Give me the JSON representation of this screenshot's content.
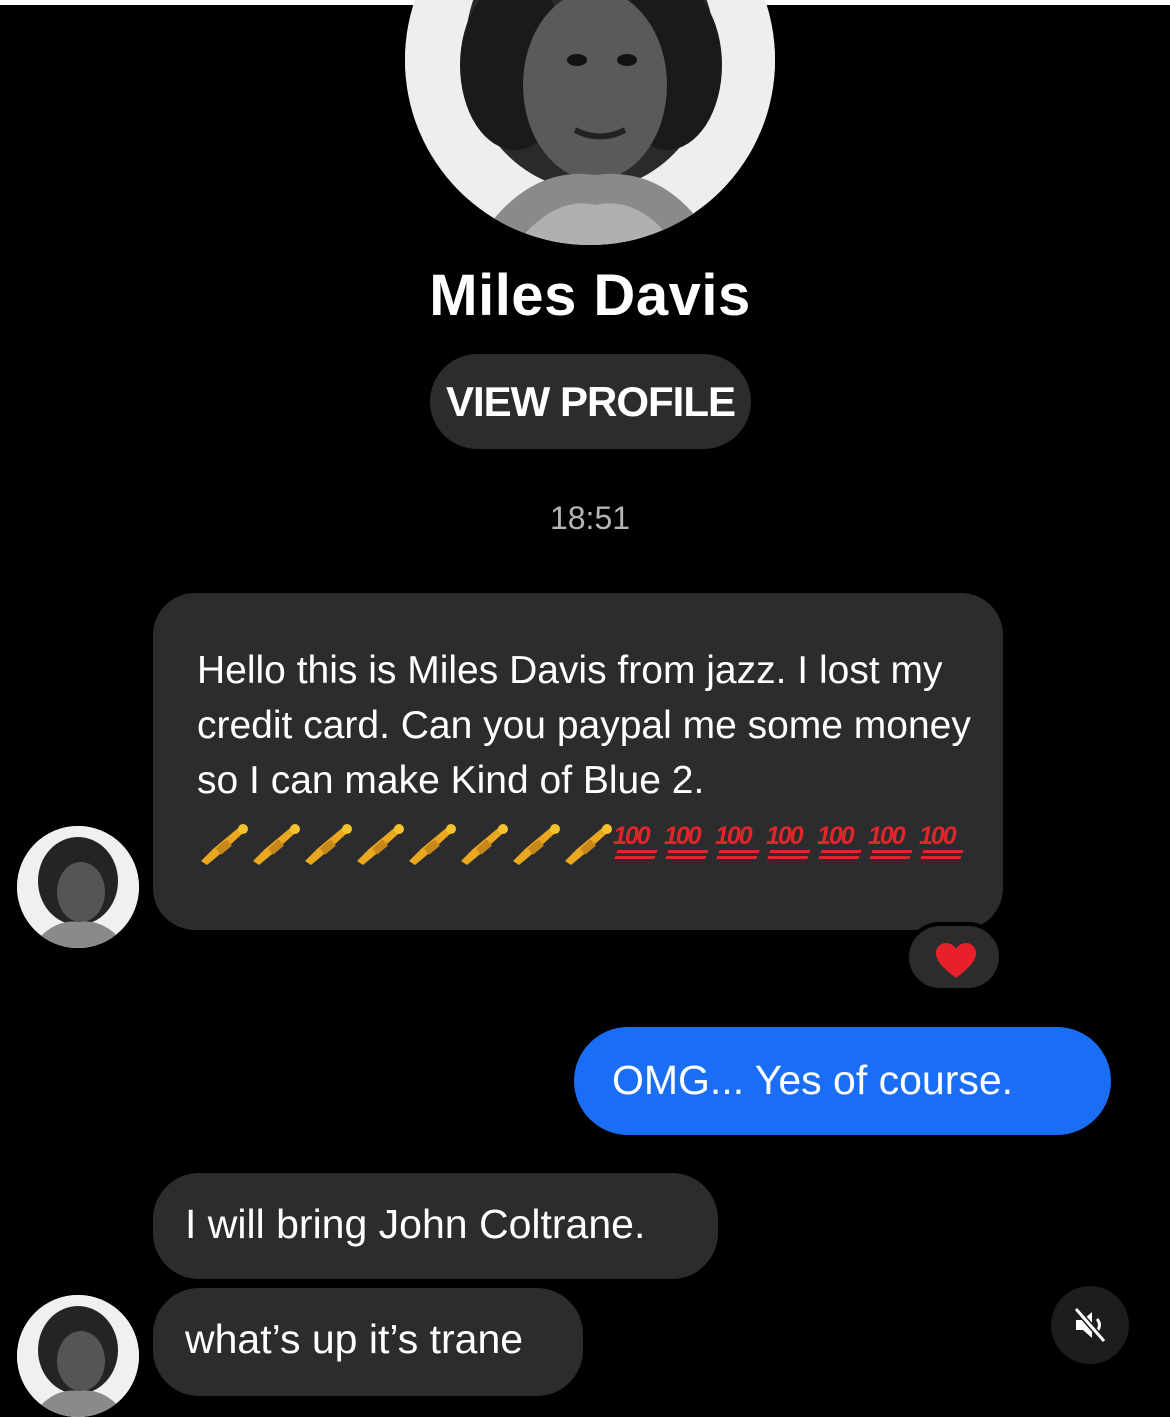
{
  "contact": {
    "name": "Miles Davis",
    "view_profile_label": "VIEW PROFILE"
  },
  "conversation": {
    "timestamp": "18:51",
    "messages": [
      {
        "from": "contact",
        "text": "Hello this is Miles Davis from jazz. I lost my credit card. Can you paypal me some money so I can make Kind of Blue 2.",
        "emojis": [
          "trumpet",
          "trumpet",
          "trumpet",
          "trumpet",
          "trumpet",
          "trumpet",
          "trumpet",
          "trumpet",
          "100",
          "100",
          "100",
          "100",
          "100",
          "100",
          "100"
        ],
        "reaction": "red-heart"
      },
      {
        "from": "me",
        "text": "OMG... Yes of course."
      },
      {
        "from": "contact",
        "text": "I will bring John Coltrane."
      },
      {
        "from": "contact",
        "text": "what’s up it’s trane"
      }
    ]
  },
  "colors": {
    "background": "#000000",
    "incoming_bubble": "#2c2c2e",
    "outgoing_bubble": "#1a6ef5",
    "heart": "#e8202a"
  },
  "icons": {
    "mute": "speaker-muted-icon"
  }
}
